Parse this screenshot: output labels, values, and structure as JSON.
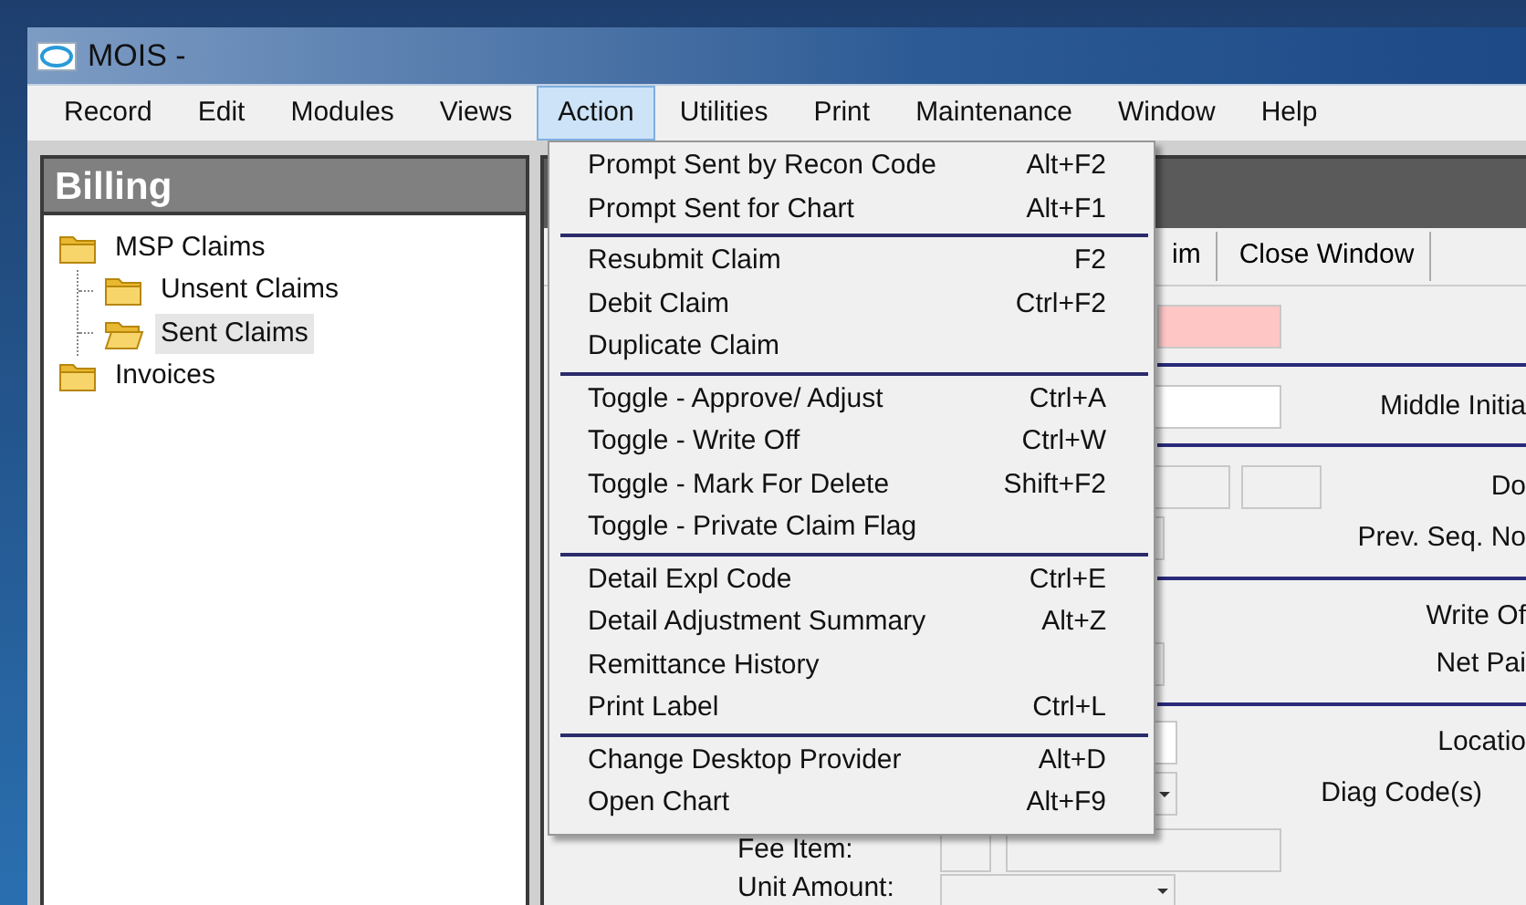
{
  "window": {
    "title": "MOIS -"
  },
  "menu_bar": [
    {
      "label": "Record",
      "selected": false
    },
    {
      "label": "Edit",
      "selected": false
    },
    {
      "label": "Modules",
      "selected": false
    },
    {
      "label": "Views",
      "selected": false
    },
    {
      "label": "Action",
      "selected": true
    },
    {
      "label": "Utilities",
      "selected": false
    },
    {
      "label": "Print",
      "selected": false
    },
    {
      "label": "Maintenance",
      "selected": false
    },
    {
      "label": "Window",
      "selected": false
    },
    {
      "label": "Help",
      "selected": false
    }
  ],
  "sidebar": {
    "title": "Billing",
    "tree": [
      {
        "label": "MSP Claims",
        "selected": false,
        "children": [
          {
            "label": "Unsent Claims",
            "selected": false
          },
          {
            "label": "Sent Claims",
            "selected": true
          }
        ]
      },
      {
        "label": "Invoices",
        "selected": false
      }
    ]
  },
  "toolbar": [
    "im",
    "Close Window"
  ],
  "form": {
    "labels": [
      "Middle Initia",
      "Do",
      "Prev. Seq. No",
      "Write Of",
      "Net Pai",
      "Locatio",
      "Diag Code(s)",
      "Fee Item:",
      "Unit Amount:"
    ]
  },
  "action_menu": {
    "sections": [
      [
        {
          "label": "Prompt Sent by Recon Code",
          "shortcut": "Alt+F2"
        },
        {
          "label": "Prompt Sent for Chart",
          "shortcut": "Alt+F1"
        }
      ],
      [
        {
          "label": "Resubmit Claim",
          "shortcut": "F2"
        },
        {
          "label": "Debit Claim",
          "shortcut": "Ctrl+F2"
        },
        {
          "label": "Duplicate Claim"
        }
      ],
      [
        {
          "label": "Toggle - Approve/ Adjust",
          "shortcut": "Ctrl+A"
        },
        {
          "label": "Toggle - Write Off",
          "shortcut": "Ctrl+W"
        },
        {
          "label": "Toggle - Mark For Delete",
          "shortcut": "Shift+F2"
        },
        {
          "label": "Toggle - Private Claim Flag"
        }
      ],
      [
        {
          "label": "Detail Expl Code",
          "shortcut": "Ctrl+E"
        },
        {
          "label": "Detail Adjustment Summary",
          "shortcut": "Alt+Z"
        },
        {
          "label": "Remittance History"
        },
        {
          "label": "Print Label",
          "shortcut": "Ctrl+L"
        }
      ],
      [
        {
          "label": "Change Desktop Provider",
          "shortcut": "Alt+D"
        },
        {
          "label": "Open Chart",
          "shortcut": "Alt+F9"
        }
      ]
    ]
  }
}
